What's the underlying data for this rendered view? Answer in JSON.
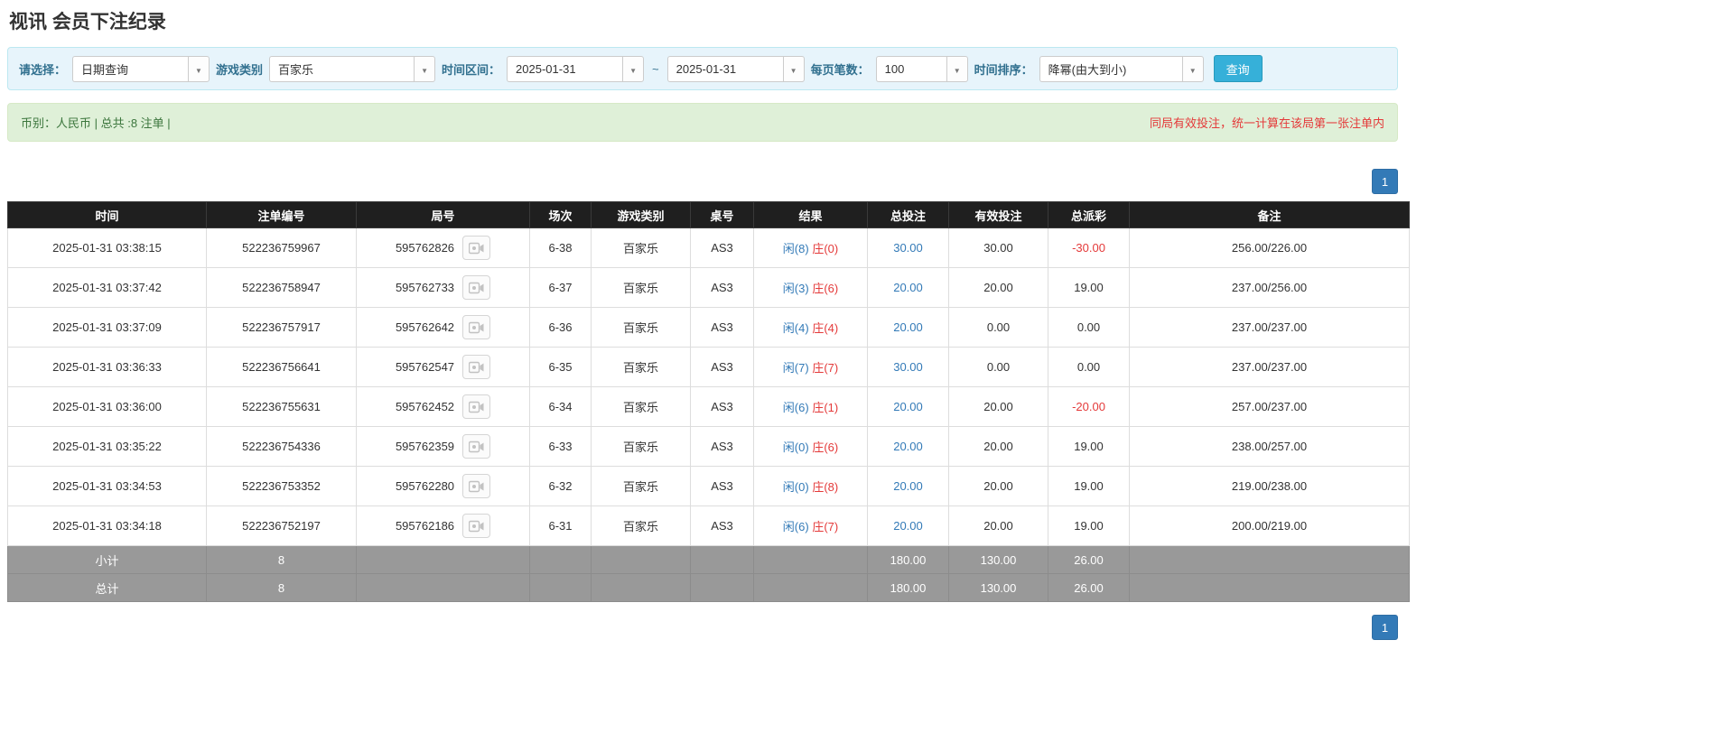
{
  "page": {
    "title": "视讯 会员下注纪录"
  },
  "icons": {
    "caret_down": "▼"
  },
  "filters": {
    "select_label": "请选择：",
    "select_value": "日期查询",
    "game_type_label": "游戏类别",
    "game_type_value": "百家乐",
    "time_range_label": "时间区间：",
    "date_from": "2025-01-31",
    "tilde": "~",
    "date_to": "2025-01-31",
    "page_size_label": "每页笔数：",
    "page_size_value": "100",
    "sort_label": "时间排序：",
    "sort_value": "降幂(由大到小)",
    "query_button": "查询"
  },
  "summary": {
    "left": "币别：人民币 | 总共 :8 注单 |",
    "right": "同局有效投注，统一计算在该局第一张注单内"
  },
  "pagination": {
    "page": "1"
  },
  "table": {
    "headers": [
      "时间",
      "注单编号",
      "局号",
      "场次",
      "游戏类别",
      "桌号",
      "结果",
      "总投注",
      "有效投注",
      "总派彩",
      "备注"
    ],
    "rows": [
      {
        "time": "2025-01-31 03:38:15",
        "bet_id": "522236759967",
        "round_id": "595762826",
        "session": "6-38",
        "game": "百家乐",
        "table_no": "AS3",
        "result_player": "闲(8)",
        "result_banker": "庄(0)",
        "total_bet": "30.00",
        "valid_bet": "30.00",
        "payout": "-30.00",
        "remark": "256.00/226.00"
      },
      {
        "time": "2025-01-31 03:37:42",
        "bet_id": "522236758947",
        "round_id": "595762733",
        "session": "6-37",
        "game": "百家乐",
        "table_no": "AS3",
        "result_player": "闲(3)",
        "result_banker": "庄(6)",
        "total_bet": "20.00",
        "valid_bet": "20.00",
        "payout": "19.00",
        "remark": "237.00/256.00"
      },
      {
        "time": "2025-01-31 03:37:09",
        "bet_id": "522236757917",
        "round_id": "595762642",
        "session": "6-36",
        "game": "百家乐",
        "table_no": "AS3",
        "result_player": "闲(4)",
        "result_banker": "庄(4)",
        "total_bet": "20.00",
        "valid_bet": "0.00",
        "payout": "0.00",
        "remark": "237.00/237.00"
      },
      {
        "time": "2025-01-31 03:36:33",
        "bet_id": "522236756641",
        "round_id": "595762547",
        "session": "6-35",
        "game": "百家乐",
        "table_no": "AS3",
        "result_player": "闲(7)",
        "result_banker": "庄(7)",
        "total_bet": "30.00",
        "valid_bet": "0.00",
        "payout": "0.00",
        "remark": "237.00/237.00"
      },
      {
        "time": "2025-01-31 03:36:00",
        "bet_id": "522236755631",
        "round_id": "595762452",
        "session": "6-34",
        "game": "百家乐",
        "table_no": "AS3",
        "result_player": "闲(6)",
        "result_banker": "庄(1)",
        "total_bet": "20.00",
        "valid_bet": "20.00",
        "payout": "-20.00",
        "remark": "257.00/237.00"
      },
      {
        "time": "2025-01-31 03:35:22",
        "bet_id": "522236754336",
        "round_id": "595762359",
        "session": "6-33",
        "game": "百家乐",
        "table_no": "AS3",
        "result_player": "闲(0)",
        "result_banker": "庄(6)",
        "total_bet": "20.00",
        "valid_bet": "20.00",
        "payout": "19.00",
        "remark": "238.00/257.00"
      },
      {
        "time": "2025-01-31 03:34:53",
        "bet_id": "522236753352",
        "round_id": "595762280",
        "session": "6-32",
        "game": "百家乐",
        "table_no": "AS3",
        "result_player": "闲(0)",
        "result_banker": "庄(8)",
        "total_bet": "20.00",
        "valid_bet": "20.00",
        "payout": "19.00",
        "remark": "219.00/238.00"
      },
      {
        "time": "2025-01-31 03:34:18",
        "bet_id": "522236752197",
        "round_id": "595762186",
        "session": "6-31",
        "game": "百家乐",
        "table_no": "AS3",
        "result_player": "闲(6)",
        "result_banker": "庄(7)",
        "total_bet": "20.00",
        "valid_bet": "20.00",
        "payout": "19.00",
        "remark": "200.00/219.00"
      }
    ],
    "footer_rows": [
      {
        "label": "小计",
        "count": "8",
        "total_bet": "180.00",
        "valid_bet": "130.00",
        "payout": "26.00",
        "remark": ""
      },
      {
        "label": "总计",
        "count": "8",
        "total_bet": "180.00",
        "valid_bet": "130.00",
        "payout": "26.00",
        "remark": ""
      }
    ]
  }
}
